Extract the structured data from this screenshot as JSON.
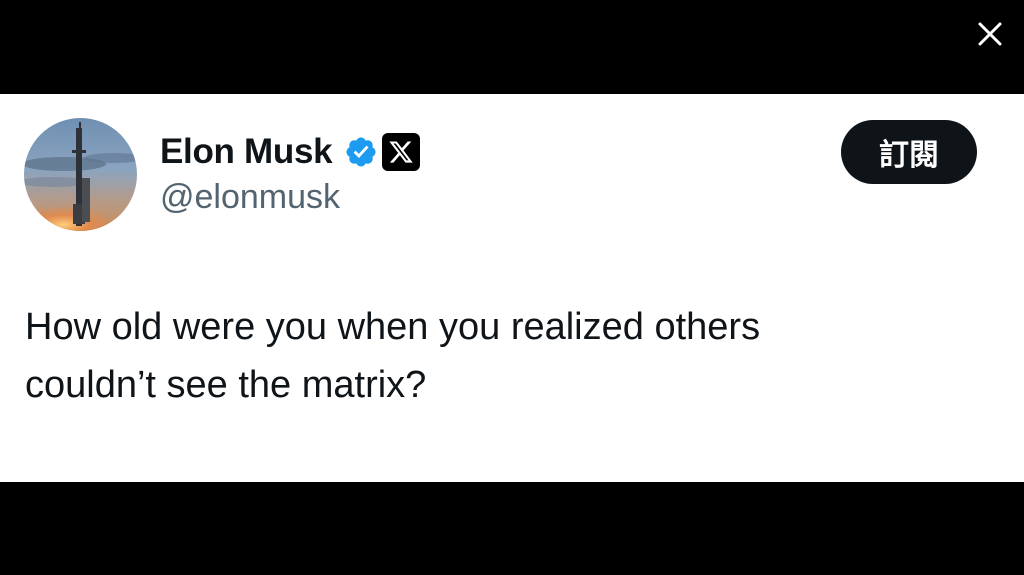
{
  "viewer": {
    "close_icon": "close-icon"
  },
  "tweet": {
    "author": {
      "display_name": "Elon Musk",
      "handle": "@elonmusk",
      "verified_icon": "verified-badge-icon",
      "affiliate_icon": "x-logo-icon",
      "avatar": "avatar"
    },
    "subscribe_label": "訂閱",
    "text_lines": [
      "How old were you when you realized others",
      "couldn’t see the matrix?"
    ]
  },
  "colors": {
    "background_dark": "#000000",
    "card_background": "#ffffff",
    "text_primary": "#0f1419",
    "text_secondary": "#536471",
    "verified_blue": "#1d9bf0",
    "button_dark": "#0f1419"
  }
}
